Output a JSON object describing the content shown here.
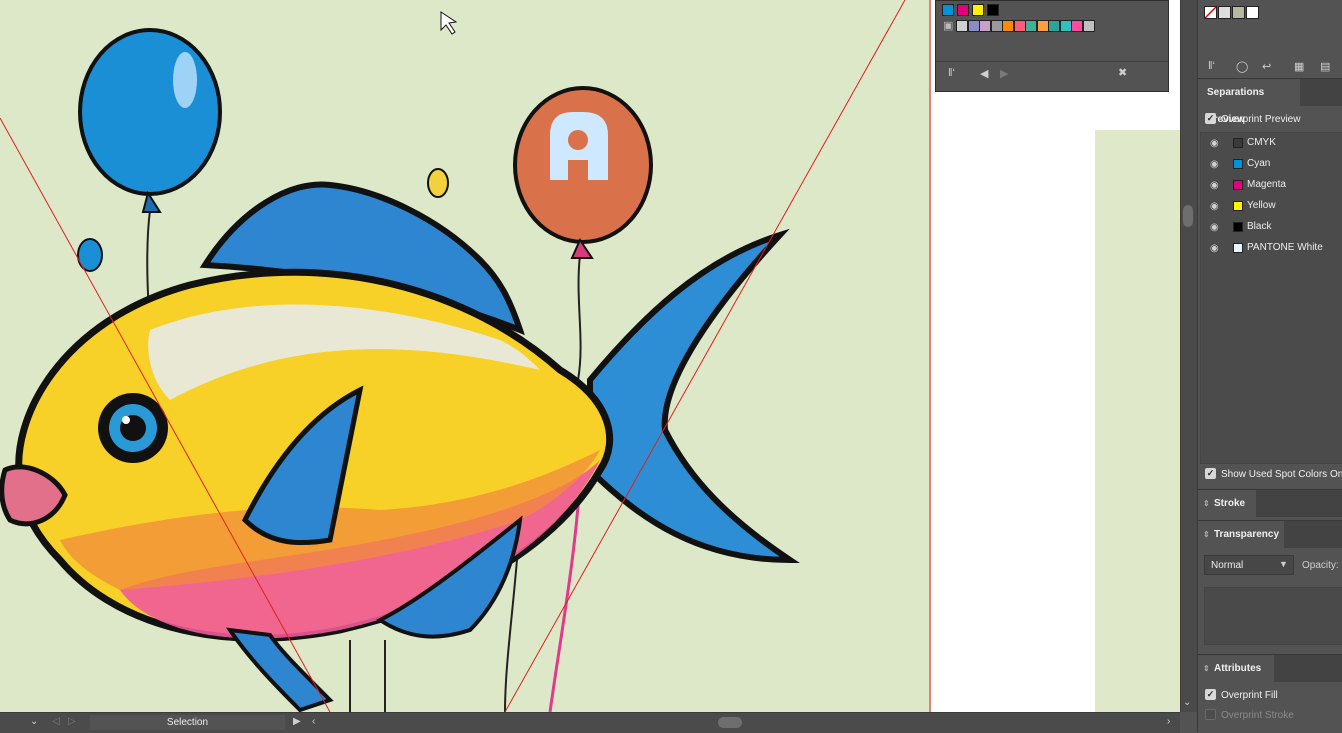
{
  "canvas": {
    "artboard_bg": "#dde8c8",
    "pasteboard_bg": "#ffffff"
  },
  "swatches": {
    "row1": [
      "#0093d8",
      "#e4007c",
      "#fff100",
      "#000000"
    ],
    "row2": [
      "#d0d0d0",
      "#8c8cc8",
      "#c8a0c8",
      "#9a9a9a",
      "#ff8a00",
      "#ff5a78",
      "#3fb09a",
      "#ffa040",
      "#2aa59a",
      "#30c0c0",
      "#ff4aa0",
      "#c0c0c0"
    ]
  },
  "separations_tab": "Separations Preview",
  "overprint_preview": {
    "label": "Overprint Preview",
    "checked": true
  },
  "separations": [
    {
      "name": "CMYK",
      "color": "#3a3a3a"
    },
    {
      "name": "Cyan",
      "color": "#0093d8"
    },
    {
      "name": "Magenta",
      "color": "#e4007c"
    },
    {
      "name": "Yellow",
      "color": "#fff100"
    },
    {
      "name": "Black",
      "color": "#000000"
    },
    {
      "name": "PANTONE White",
      "color": "#e8f4fb"
    }
  ],
  "show_spot": {
    "label": "Show Used Spot Colors Onl",
    "checked": true
  },
  "stroke_tab": "Stroke",
  "transparency_tab": "Transparency",
  "blend_mode": "Normal",
  "opacity_label": "Opacity:",
  "attributes_tab": "Attributes",
  "overprint_fill": {
    "label": "Overprint Fill",
    "checked": true
  },
  "overprint_stroke": {
    "label": "Overprint Stroke",
    "checked": false
  },
  "status": {
    "tool": "Selection"
  }
}
